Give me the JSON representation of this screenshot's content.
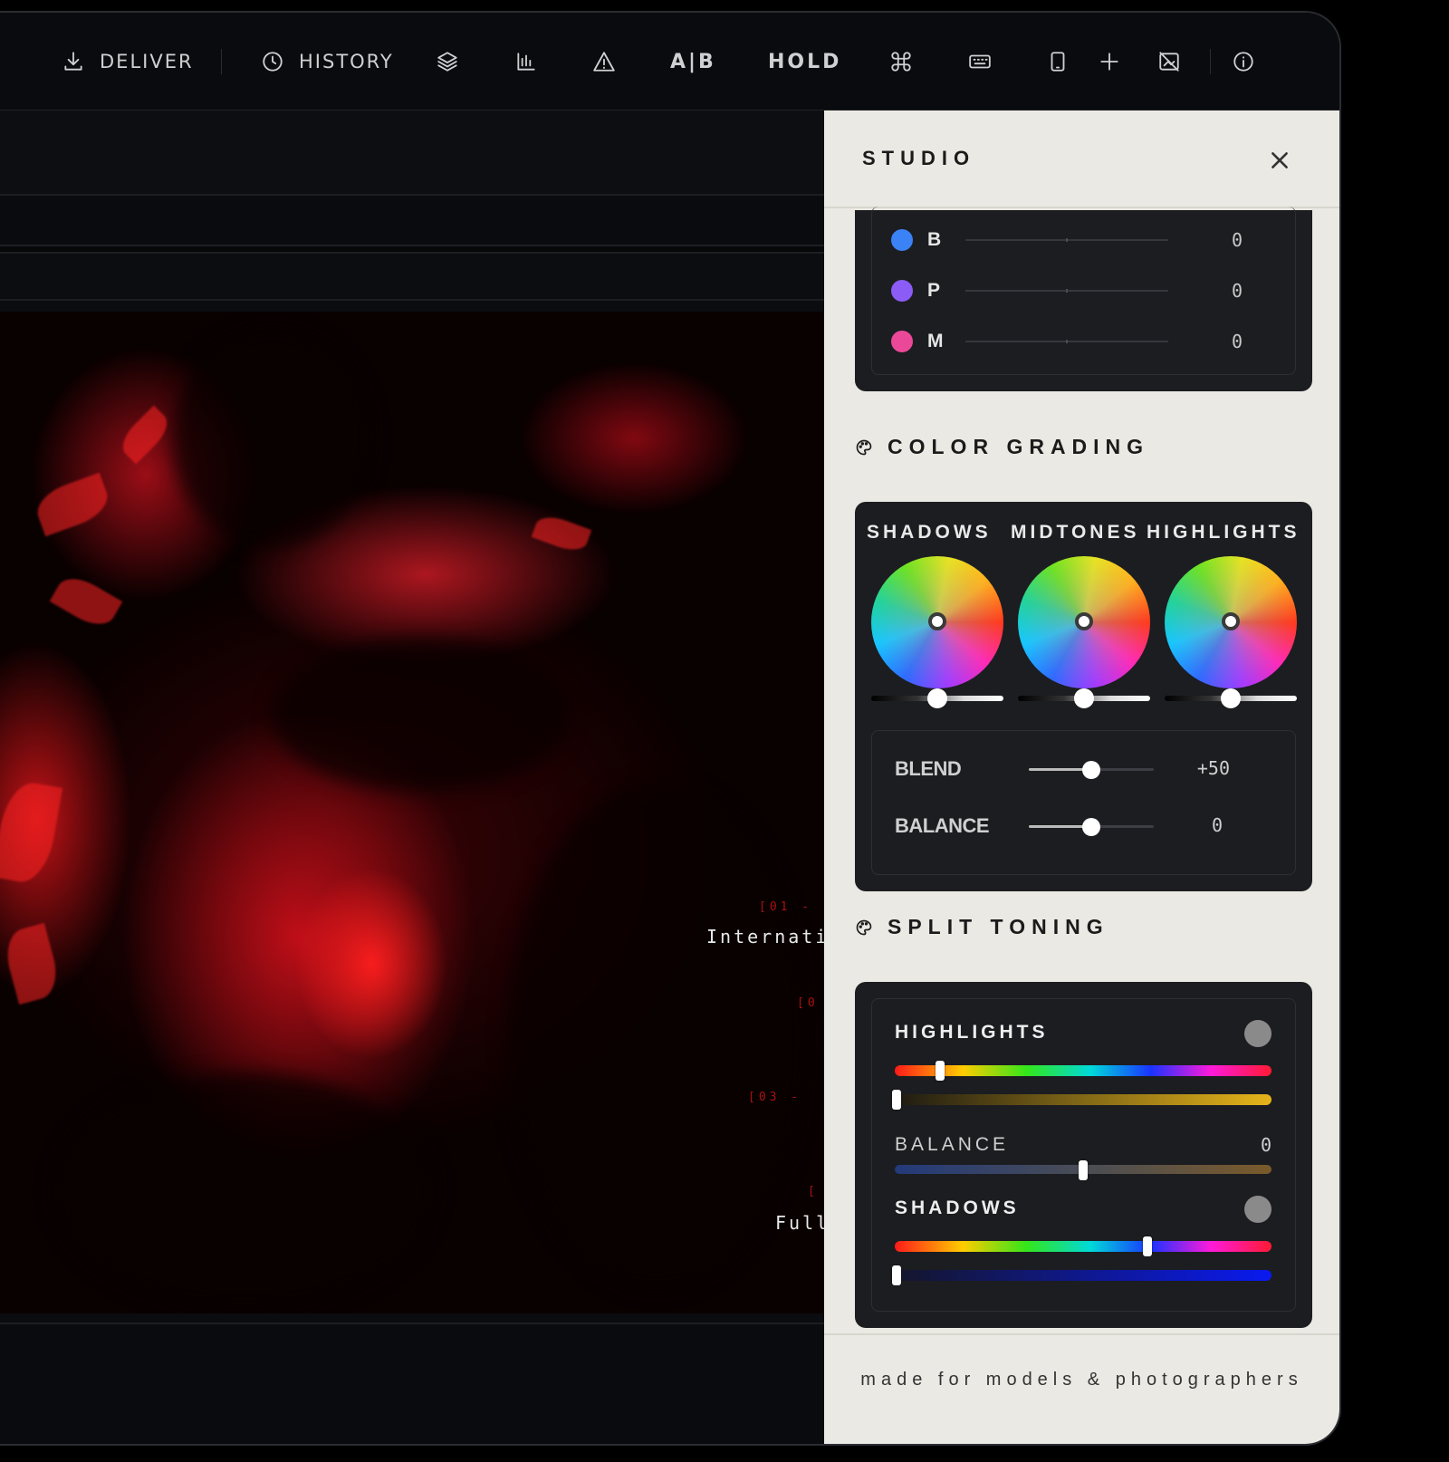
{
  "toolbar": {
    "deliver": "DELIVER",
    "history": "HISTORY",
    "ab": "A|B",
    "hold": "HOLD"
  },
  "canvas": {
    "overlay_text_1": "Internatio",
    "overlay_text_2": "Full",
    "tag_1": "[01 -",
    "tag_2": "[0",
    "tag_3": "[03 -",
    "tag_4": "["
  },
  "studio": {
    "title": "STUDIO",
    "hsl": [
      {
        "letter": "B",
        "value": "0",
        "color": "#3b82f6"
      },
      {
        "letter": "P",
        "value": "0",
        "color": "#8b5cf6"
      },
      {
        "letter": "M",
        "value": "0",
        "color": "#ec4899"
      }
    ],
    "color_grading": {
      "title": "COLOR GRADING",
      "wheels": [
        {
          "label": "SHADOWS",
          "luminance": 0.5
        },
        {
          "label": "MIDTONES",
          "luminance": 0.5
        },
        {
          "label": "HIGHLIGHTS",
          "luminance": 0.5
        }
      ],
      "blend": {
        "label": "BLEND",
        "value": "+50",
        "level": 0.5
      },
      "balance": {
        "label": "BALANCE",
        "value": "0",
        "level": 0.5
      }
    },
    "split_toning": {
      "title": "SPLIT TONING",
      "highlights": {
        "label": "HIGHLIGHTS",
        "hue": 0.12,
        "saturation": 0.0
      },
      "balance": {
        "label": "BALANCE",
        "value": "0",
        "level": 0.5
      },
      "shadows": {
        "label": "SHADOWS",
        "hue": 0.67,
        "saturation": 0.0
      }
    },
    "tagline": "made for models & photographers"
  }
}
